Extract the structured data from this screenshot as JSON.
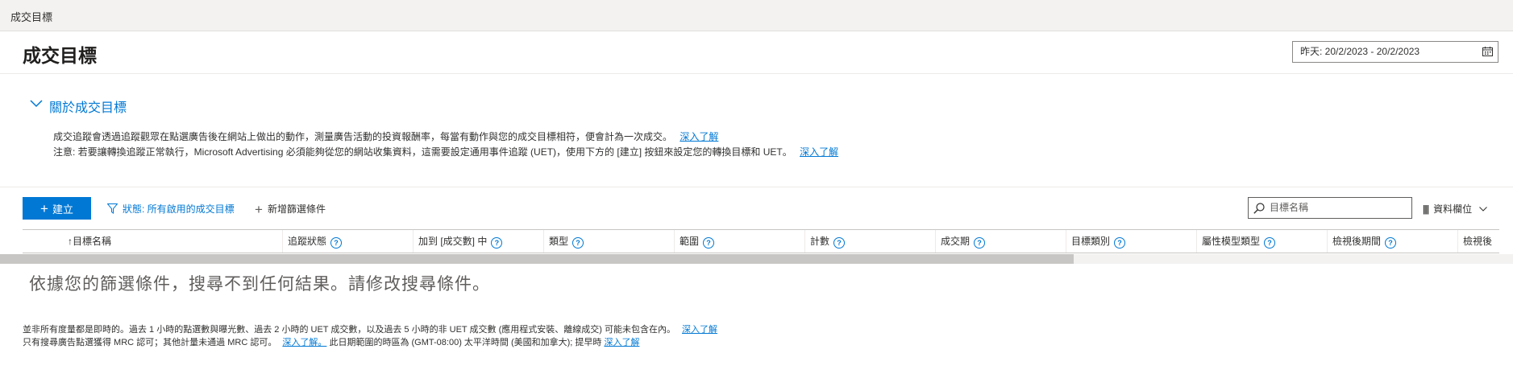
{
  "breadcrumb": "成交目標",
  "page_title": "成交目標",
  "date_range": "昨天: 20/2/2023 - 20/2/2023",
  "about": {
    "toggle_label": "關於成交目標",
    "line1": "成交追蹤會透過追蹤觀眾在點選廣告後在網站上做出的動作，測量廣告活動的投資報酬率，每當有動作與您的成交目標相符，便會計為一次成交。",
    "line1_link": "深入了解",
    "line2": "注意: 若要讓轉換追蹤正常執行，Microsoft Advertising 必須能夠從您的網站收集資料，這需要設定通用事件追蹤 (UET)，使用下方的 [建立] 按鈕來設定您的轉換目標和 UET。",
    "line2_link": "深入了解"
  },
  "toolbar": {
    "create_label": "建立",
    "filter_status": "狀態: 所有啟用的成交目標",
    "add_filter": "新增篩選條件",
    "search_placeholder": "目標名稱",
    "columns_label": "資料欄位"
  },
  "table": {
    "columns": [
      {
        "label": "目標名稱",
        "sort_icon": "↑",
        "help": false
      },
      {
        "label": "追蹤狀態",
        "help": true
      },
      {
        "label": "加到 [成交數] 中",
        "help": true
      },
      {
        "label": "類型",
        "help": true
      },
      {
        "label": "範圍",
        "help": true
      },
      {
        "label": "計數",
        "help": true
      },
      {
        "label": "成交期",
        "help": true
      },
      {
        "label": "目標類別",
        "help": true
      },
      {
        "label": "屬性模型類型",
        "help": true
      },
      {
        "label": "檢視後期間",
        "help": true
      },
      {
        "label": "檢視後",
        "help": false
      }
    ],
    "empty_message": "依據您的篩選條件，搜尋不到任何結果。請修改搜尋條件。"
  },
  "footer": {
    "line1": "並非所有度量都是即時的。過去 1 小時的點選數與曝光數、過去 2 小時的 UET 成交數，以及過去 5 小時的非 UET 成交數 (應用程式安裝、離線成交) 可能未包含在內。",
    "line1_link": "深入了解",
    "line2_a": "只有搜尋廣告點選獲得 MRC 認可；其他計量未通過 MRC 認可。",
    "line2_link1": "深入了解。",
    "line2_b": "此日期範圍的時區為 (GMT-08:00) 太平洋時間 (美國和加拿大); 提早時",
    "line2_link2": "深入了解"
  },
  "colors": {
    "accent": "#0078d4",
    "top_bar": "#f3f2f1",
    "text": "#323130"
  }
}
